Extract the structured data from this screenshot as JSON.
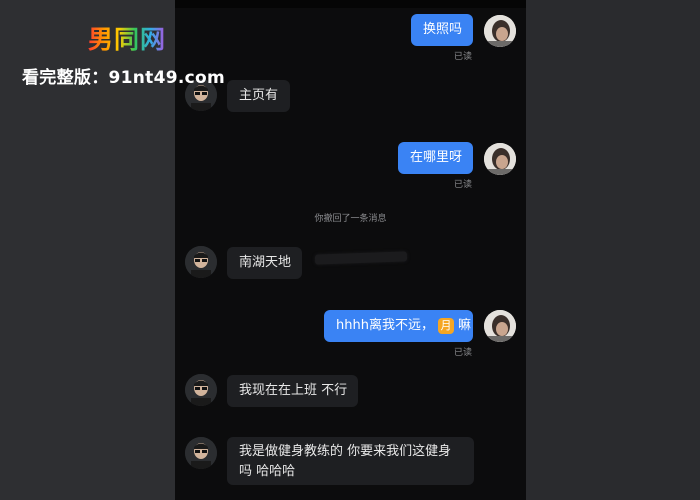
{
  "watermark": {
    "logo": "男同网",
    "url": "看完整版：91nt49.com"
  },
  "chat": {
    "recall_notice": "你撤回了一条消息",
    "messages": [
      {
        "from": "me",
        "text": "换照吗",
        "status": "已读"
      },
      {
        "from": "other",
        "text": "主页有"
      },
      {
        "from": "me",
        "text": "在哪里呀",
        "status": "已读"
      },
      {
        "from": "other",
        "text": "南湖天地"
      },
      {
        "from": "me",
        "text_before": "hhhh离我不远，",
        "emoji_text": "月",
        "text_after": "嘛",
        "status": "已读"
      },
      {
        "from": "other",
        "text": "我现在在上班 不行"
      },
      {
        "from": "other",
        "text": "我是做健身教练的 你要来我们这健身吗 哈哈哈"
      }
    ]
  },
  "colors": {
    "my_bubble": "#3a83f4",
    "their_bubble": "#1e1f22",
    "chat_background": "#0c0c0d"
  }
}
